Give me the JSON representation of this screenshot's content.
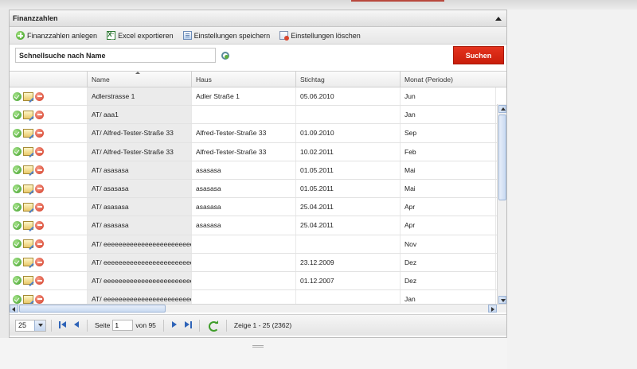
{
  "panel": {
    "title": "Finanzzahlen"
  },
  "toolbar": {
    "add_label": "Finanzzahlen anlegen",
    "excel_label": "Excel exportieren",
    "save_label": "Einstellungen speichern",
    "delete_label": "Einstellungen löschen"
  },
  "search": {
    "placeholder": "Schnellsuche nach Name",
    "button_label": "Suchen"
  },
  "grid": {
    "columns": [
      "",
      "Name",
      "Haus",
      "Stichtag",
      "Monat (Periode)"
    ],
    "rows": [
      [
        "Adlerstrasse 1",
        "Adler Straße 1",
        "05.06.2010",
        "Jun"
      ],
      [
        "AT/ aaa1",
        "",
        "",
        "Jan"
      ],
      [
        "AT/ Alfred-Tester-Straße 33",
        "Alfred-Tester-Straße 33",
        "01.09.2010",
        "Sep"
      ],
      [
        "AT/ Alfred-Tester-Straße 33",
        "Alfred-Tester-Straße 33",
        "10.02.2011",
        "Feb"
      ],
      [
        "AT/ asasasa",
        "asasasa",
        "01.05.2011",
        "Mai"
      ],
      [
        "AT/ asasasa",
        "asasasa",
        "01.05.2011",
        "Mai"
      ],
      [
        "AT/ asasasa",
        "asasasa",
        "25.04.2011",
        "Apr"
      ],
      [
        "AT/ asasasa",
        "asasasa",
        "25.04.2011",
        "Apr"
      ],
      [
        "AT/ eeeeeeeeeeeeeeeeeeeeeeee",
        "",
        "",
        "Nov"
      ],
      [
        "AT/ eeeeeeeeeeeeeeeeeeeeeeee",
        "",
        "23.12.2009",
        "Dez"
      ],
      [
        "AT/ eeeeeeeeeeeeeeeeeeeeeeee",
        "",
        "01.12.2007",
        "Dez"
      ],
      [
        "AT/ eeeeeeeeeeeeeeeeeeeeeeee",
        "",
        "",
        "Jan"
      ]
    ]
  },
  "pager": {
    "page_size": "25",
    "page_label": "Seite",
    "current_page": "1",
    "of_label": "von 95",
    "summary": "Zeige 1 - 25 (2362)"
  },
  "colors": {
    "accent": "#d42a16",
    "header_bg": "#e3e3e3",
    "link_blue": "#2f64b8"
  }
}
